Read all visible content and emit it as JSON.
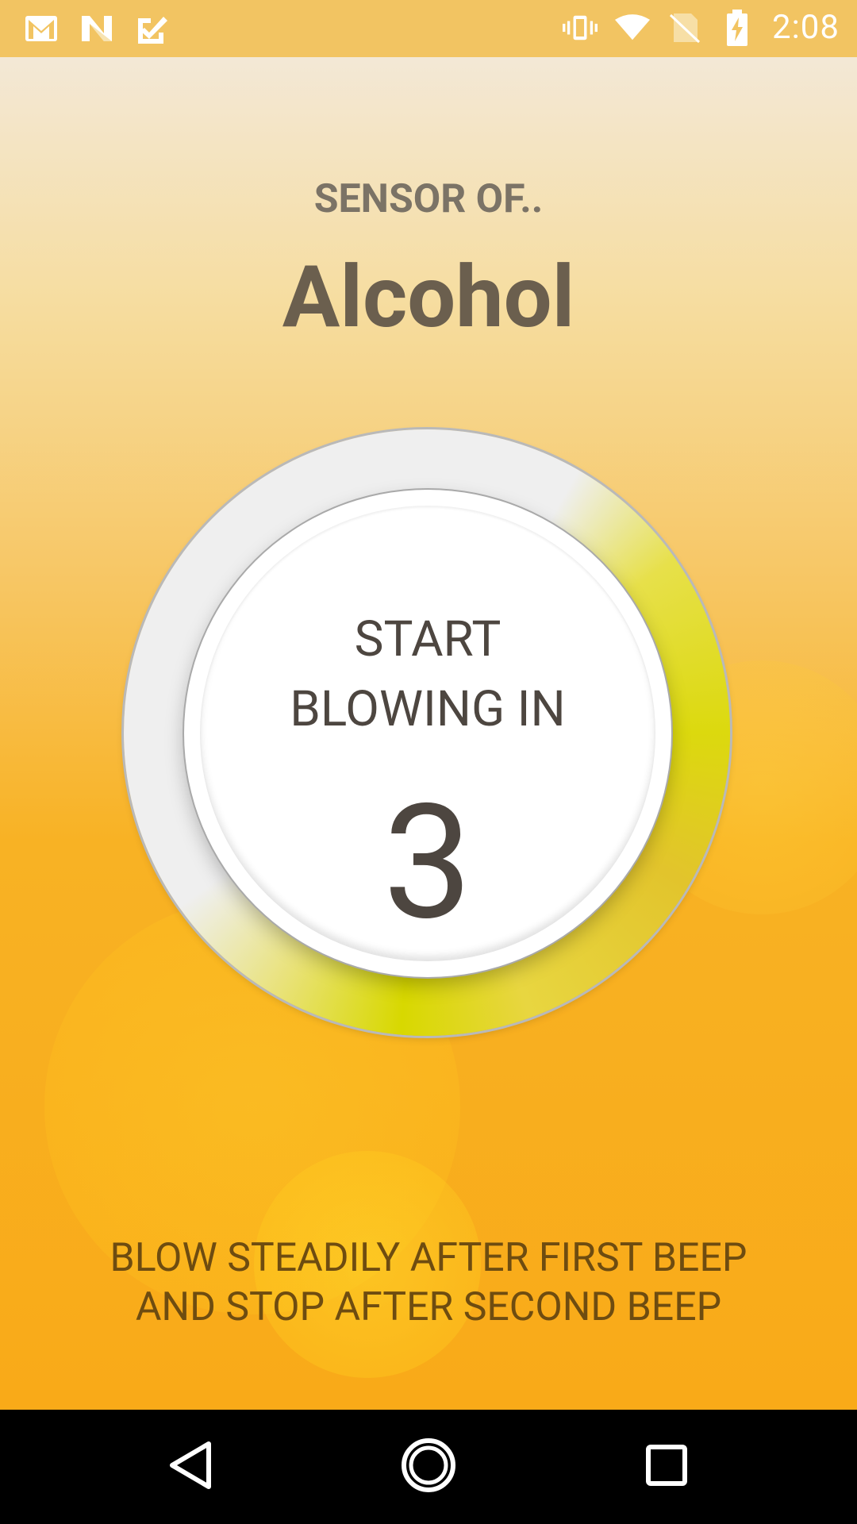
{
  "status_bar": {
    "left_icons": [
      "gmail-icon",
      "n-app-icon",
      "task-check-icon"
    ],
    "right_icons": [
      "vibrate-icon",
      "wifi-icon",
      "no-sim-icon",
      "battery-charging-icon"
    ],
    "time": "2:08"
  },
  "screen": {
    "sensor_label": "SENSOR OF..",
    "sensor_name": "Alcohol",
    "gauge": {
      "prompt_line1": "START",
      "prompt_line2": "BLOWING IN",
      "countdown": "3"
    },
    "instruction": "BLOW STEADILY AFTER FIRST BEEP\nAND STOP AFTER SECOND BEEP"
  },
  "nav_bar": {
    "buttons": [
      "back-icon",
      "home-icon",
      "recents-icon"
    ]
  },
  "colors": {
    "status_bar": "#f2c462",
    "gauge_accent": "#dcd90e",
    "text_dark": "#4d4640",
    "instruction_text": "#6e4c10"
  }
}
